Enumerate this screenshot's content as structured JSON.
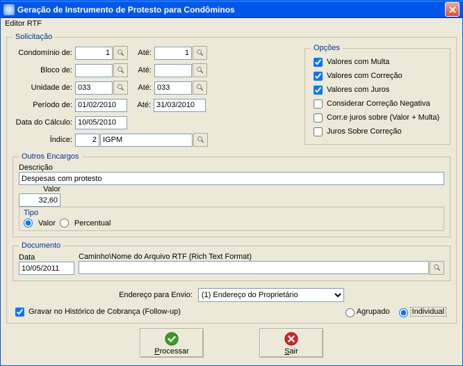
{
  "title": "Geração de Instrumento de Protesto  para Condôminos",
  "menu": {
    "editor_rtf": "Editor RTF"
  },
  "solicitacao": {
    "legend": "Solicitação",
    "labels": {
      "condominio": "Condomínio de:",
      "bloco": "Bloco de:",
      "unidade": "Unidade de:",
      "periodo": "Período de:",
      "data_calculo": "Data do Cálculo:",
      "indice": "Índice:",
      "ate": "Até:"
    },
    "values": {
      "condominio_de": "1",
      "condominio_ate": "1",
      "bloco_de": "",
      "bloco_ate": "",
      "unidade_de": "033",
      "unidade_ate": "033",
      "periodo_de": "01/02/2010",
      "periodo_ate": "31/03/2010",
      "data_calculo": "10/05/2010",
      "indice_num": "2",
      "indice_nome": "IGPM"
    }
  },
  "opcoes": {
    "legend": "Opções",
    "items": {
      "valores_multa": "Valores com Multa",
      "valores_correcao": "Valores com Correção",
      "valores_juros": "Valores com Juros",
      "correcao_negativa": "Considerar Correção Negativa",
      "corr_juros_valor_multa": "Corr.e juros sobre (Valor + Multa)",
      "juros_sobre_correcao": "Juros Sobre Correção"
    }
  },
  "outros": {
    "legend": "Outros Encargos",
    "descricao_label": "Descrição",
    "descricao_value": "Despesas com protesto",
    "valor_label": "Valor",
    "valor_value": "32,60",
    "tipo_label": "Tipo",
    "tipo_valor": "Valor",
    "tipo_percentual": "Percentual"
  },
  "documento": {
    "legend": "Documento",
    "data_label": "Data",
    "data_value": "10/05/2011",
    "caminho_label": "Caminho\\Nome do Arquivo RTF (Rich Text Format)",
    "caminho_value": ""
  },
  "endereco": {
    "label": "Endereço para Envio:",
    "selected": "(1) Endereço do Proprietário"
  },
  "bottom": {
    "gravar": "Gravar no Histórico de Cobrança (Follow-up)",
    "agrupado": "Agrupado",
    "individual": "Individual"
  },
  "buttons": {
    "processar": "Processar",
    "sair": "Sair"
  }
}
